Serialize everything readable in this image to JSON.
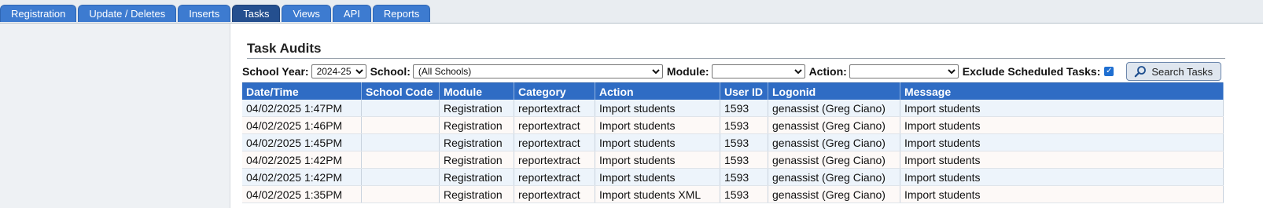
{
  "tabs": [
    {
      "label": "Registration",
      "active": false
    },
    {
      "label": "Update / Deletes",
      "active": false
    },
    {
      "label": "Inserts",
      "active": false
    },
    {
      "label": "Tasks",
      "active": true
    },
    {
      "label": "Views",
      "active": false
    },
    {
      "label": "API",
      "active": false
    },
    {
      "label": "Reports",
      "active": false
    }
  ],
  "page": {
    "title": "Task Audits"
  },
  "filters": {
    "school_year_label": "School Year:",
    "school_year_value": "2024-25",
    "school_label": "School:",
    "school_value": "(All Schools)",
    "module_label": "Module:",
    "module_value": "",
    "action_label": "Action:",
    "action_value": "",
    "exclude_label": "Exclude Scheduled Tasks:",
    "exclude_checked": true,
    "search_button": "Search Tasks"
  },
  "table": {
    "columns": [
      "Date/Time",
      "School Code",
      "Module",
      "Category",
      "Action",
      "User ID",
      "Logonid",
      "Message"
    ],
    "rows": [
      [
        "04/02/2025 1:47PM",
        "",
        "Registration",
        "reportextract",
        "Import students",
        "1593",
        "genassist (Greg Ciano)",
        "Import students"
      ],
      [
        "04/02/2025 1:46PM",
        "",
        "Registration",
        "reportextract",
        "Import students",
        "1593",
        "genassist (Greg Ciano)",
        "Import students"
      ],
      [
        "04/02/2025 1:45PM",
        "",
        "Registration",
        "reportextract",
        "Import students",
        "1593",
        "genassist (Greg Ciano)",
        "Import students"
      ],
      [
        "04/02/2025 1:42PM",
        "",
        "Registration",
        "reportextract",
        "Import students",
        "1593",
        "genassist (Greg Ciano)",
        "Import students"
      ],
      [
        "04/02/2025 1:42PM",
        "",
        "Registration",
        "reportextract",
        "Import students",
        "1593",
        "genassist (Greg Ciano)",
        "Import students"
      ],
      [
        "04/02/2025 1:35PM",
        "",
        "Registration",
        "reportextract",
        "Import students XML",
        "1593",
        "genassist (Greg Ciano)",
        "Import students"
      ]
    ]
  },
  "colors": {
    "tab": "#3d7bd0",
    "tab_active": "#244f8f",
    "header": "#2f6cc4"
  }
}
